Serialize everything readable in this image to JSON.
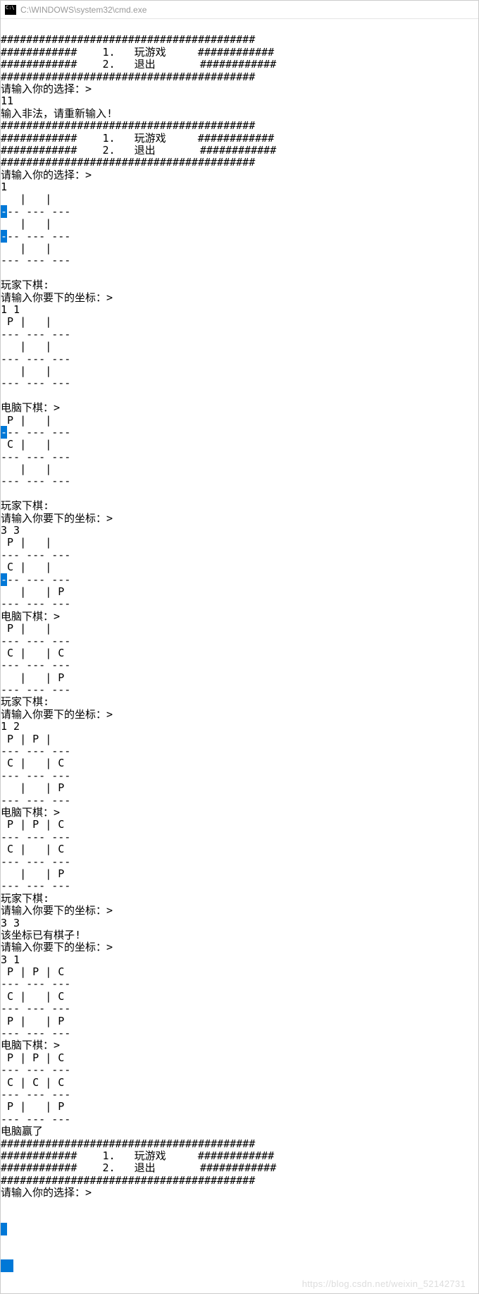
{
  "window": {
    "title": "C:\\WINDOWS\\system32\\cmd.exe"
  },
  "watermark": "https://blog.csdn.net/weixin_52142731",
  "menu": {
    "border": "########################################",
    "row_play": "############    1.   玩游戏     ############",
    "row_exit": "############    2.   退出       ############"
  },
  "prompts": {
    "choose": "请输入你的选择：",
    "invalid": "输入非法，请重新输入!",
    "player_turn": "玩家下棋:",
    "enter_coord": "请输入你要下的坐标：",
    "cpu_turn": "电脑下棋：",
    "occupied": "该坐标已有棋子!",
    "cpu_win": "电脑赢了"
  },
  "inputs": {
    "c1": "11",
    "c2": "1",
    "c3": "1 1",
    "c4": "3 3",
    "c5": "1 2",
    "c6": "3 3",
    "c7": "3 1"
  },
  "boards": {
    "sep": "--- --- ---",
    "empty_row": "   |   |   ",
    "b1_r1": " P |   |   ",
    "b2_r1": " P |   |   ",
    "b2_r2": " C |   |   ",
    "b3_r1": " P |   |   ",
    "b3_r2": " C |   |   ",
    "b3_r3": "   |   | P ",
    "b4_r1": " P |   |   ",
    "b4_r2": " C |   | C ",
    "b4_r3": "   |   | P ",
    "b5_r1": " P | P |   ",
    "b5_r2": " C |   | C ",
    "b5_r3": "   |   | P ",
    "b6_r1": " P | P | C ",
    "b6_r2": " C |   | C ",
    "b6_r3": "   |   | P ",
    "b7_r1": " P | P | C ",
    "b7_r2": " C |   | C ",
    "b7_r3": " P |   | P ",
    "b8_r1": " P | P | C ",
    "b8_r2": " C | C | C ",
    "b8_r3": " P |   | P "
  },
  "caret": ">"
}
